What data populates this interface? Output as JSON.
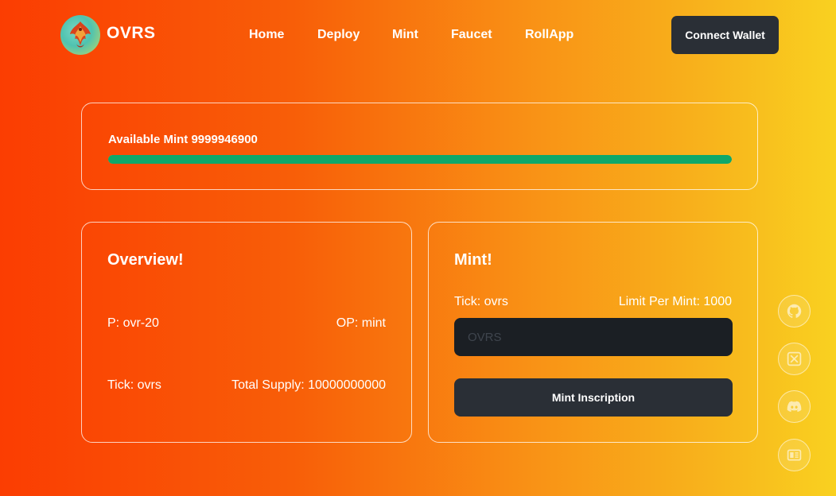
{
  "header": {
    "brand": "OVRS",
    "nav": [
      "Home",
      "Deploy",
      "Mint",
      "Faucet",
      "RollApp"
    ],
    "connect_label": "Connect Wallet"
  },
  "available": {
    "label": "Available Mint 9999946900",
    "progress_fraction": 0.99999469
  },
  "overview": {
    "title": "Overview!",
    "p": "P: ovr-20",
    "op": "OP: mint",
    "tick": "Tick: ovrs",
    "total_supply": "Total Supply: 10000000000"
  },
  "mint": {
    "title": "Mint!",
    "tick": "Tick: ovrs",
    "limit": "Limit Per Mint: 1000",
    "input_placeholder": "OVRS",
    "button_label": "Mint Inscription"
  },
  "social_icons": [
    "github-icon",
    "x-icon",
    "discord-icon",
    "docs-icon"
  ],
  "colors": {
    "progress": "#0ea86a",
    "button_dark": "#2a2f36",
    "input_dark": "#1b1f24"
  }
}
